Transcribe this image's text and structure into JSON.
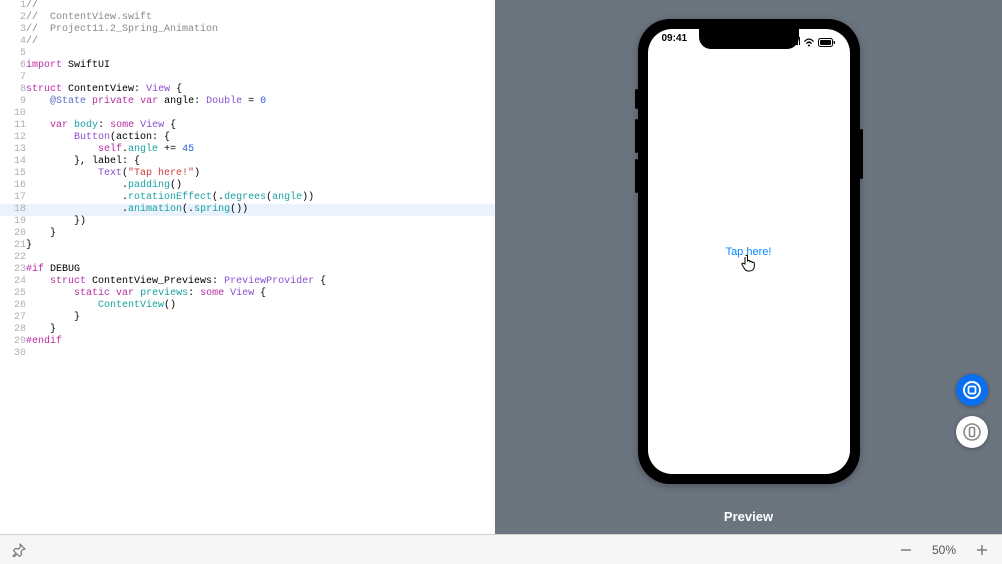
{
  "editor": {
    "highlighted_line": 18,
    "lines": [
      {
        "n": 1,
        "seg": [
          {
            "t": "//",
            "c": "c-comment"
          }
        ]
      },
      {
        "n": 2,
        "seg": [
          {
            "t": "//  ContentView.swift",
            "c": "c-comment"
          }
        ]
      },
      {
        "n": 3,
        "seg": [
          {
            "t": "//  Project11.2_Spring_Animation",
            "c": "c-comment"
          }
        ]
      },
      {
        "n": 4,
        "seg": [
          {
            "t": "//",
            "c": "c-comment"
          }
        ]
      },
      {
        "n": 5,
        "seg": [
          {
            "t": "",
            "c": ""
          }
        ]
      },
      {
        "n": 6,
        "seg": [
          {
            "t": "import",
            "c": "c-key"
          },
          {
            "t": " ",
            "c": ""
          },
          {
            "t": "SwiftUI",
            "c": "c-black"
          }
        ]
      },
      {
        "n": 7,
        "seg": [
          {
            "t": "",
            "c": ""
          }
        ]
      },
      {
        "n": 8,
        "seg": [
          {
            "t": "struct",
            "c": "c-key"
          },
          {
            "t": " ",
            "c": ""
          },
          {
            "t": "ContentView",
            "c": "c-black"
          },
          {
            "t": ": ",
            "c": ""
          },
          {
            "t": "View",
            "c": "c-purple"
          },
          {
            "t": " {",
            "c": ""
          }
        ]
      },
      {
        "n": 9,
        "seg": [
          {
            "t": "    ",
            "c": ""
          },
          {
            "t": "@State",
            "c": "c-type"
          },
          {
            "t": " ",
            "c": ""
          },
          {
            "t": "private",
            "c": "c-key"
          },
          {
            "t": " ",
            "c": ""
          },
          {
            "t": "var",
            "c": "c-key"
          },
          {
            "t": " angle: ",
            "c": ""
          },
          {
            "t": "Double",
            "c": "c-purple"
          },
          {
            "t": " = ",
            "c": ""
          },
          {
            "t": "0",
            "c": "c-num"
          }
        ]
      },
      {
        "n": 10,
        "seg": [
          {
            "t": "",
            "c": ""
          }
        ]
      },
      {
        "n": 11,
        "seg": [
          {
            "t": "    ",
            "c": ""
          },
          {
            "t": "var",
            "c": "c-key"
          },
          {
            "t": " ",
            "c": ""
          },
          {
            "t": "body",
            "c": "c-teal"
          },
          {
            "t": ": ",
            "c": ""
          },
          {
            "t": "some",
            "c": "c-key"
          },
          {
            "t": " ",
            "c": ""
          },
          {
            "t": "View",
            "c": "c-purple"
          },
          {
            "t": " {",
            "c": ""
          }
        ]
      },
      {
        "n": 12,
        "seg": [
          {
            "t": "        ",
            "c": ""
          },
          {
            "t": "Button",
            "c": "c-purple"
          },
          {
            "t": "(action: {",
            "c": ""
          }
        ]
      },
      {
        "n": 13,
        "seg": [
          {
            "t": "            ",
            "c": ""
          },
          {
            "t": "self",
            "c": "c-key"
          },
          {
            "t": ".",
            "c": ""
          },
          {
            "t": "angle",
            "c": "c-teal"
          },
          {
            "t": " += ",
            "c": ""
          },
          {
            "t": "45",
            "c": "c-num"
          }
        ]
      },
      {
        "n": 14,
        "seg": [
          {
            "t": "        }, label: {",
            "c": ""
          }
        ]
      },
      {
        "n": 15,
        "seg": [
          {
            "t": "            ",
            "c": ""
          },
          {
            "t": "Text",
            "c": "c-purple"
          },
          {
            "t": "(",
            "c": ""
          },
          {
            "t": "\"Tap here!\"",
            "c": "c-string"
          },
          {
            "t": ")",
            "c": ""
          }
        ]
      },
      {
        "n": 16,
        "seg": [
          {
            "t": "                .",
            "c": ""
          },
          {
            "t": "padding",
            "c": "c-teal"
          },
          {
            "t": "()",
            "c": ""
          }
        ]
      },
      {
        "n": 17,
        "seg": [
          {
            "t": "                .",
            "c": ""
          },
          {
            "t": "rotationEffect",
            "c": "c-teal"
          },
          {
            "t": "(.",
            "c": ""
          },
          {
            "t": "degrees",
            "c": "c-teal"
          },
          {
            "t": "(",
            "c": ""
          },
          {
            "t": "angle",
            "c": "c-teal"
          },
          {
            "t": "))",
            "c": ""
          }
        ]
      },
      {
        "n": 18,
        "seg": [
          {
            "t": "                .",
            "c": ""
          },
          {
            "t": "animation",
            "c": "c-teal"
          },
          {
            "t": "(.",
            "c": ""
          },
          {
            "t": "spring",
            "c": "c-teal"
          },
          {
            "t": "())",
            "c": ""
          }
        ]
      },
      {
        "n": 19,
        "seg": [
          {
            "t": "        })",
            "c": ""
          }
        ]
      },
      {
        "n": 20,
        "seg": [
          {
            "t": "    }",
            "c": ""
          }
        ]
      },
      {
        "n": 21,
        "seg": [
          {
            "t": "}",
            "c": ""
          }
        ]
      },
      {
        "n": 22,
        "seg": [
          {
            "t": "",
            "c": ""
          }
        ]
      },
      {
        "n": 23,
        "seg": [
          {
            "t": "#if",
            "c": "c-key"
          },
          {
            "t": " DEBUG",
            "c": ""
          }
        ]
      },
      {
        "n": 24,
        "seg": [
          {
            "t": "    ",
            "c": ""
          },
          {
            "t": "struct",
            "c": "c-key"
          },
          {
            "t": " ContentView_Previews: ",
            "c": ""
          },
          {
            "t": "PreviewProvider",
            "c": "c-purple"
          },
          {
            "t": " {",
            "c": ""
          }
        ]
      },
      {
        "n": 25,
        "seg": [
          {
            "t": "        ",
            "c": ""
          },
          {
            "t": "static",
            "c": "c-key"
          },
          {
            "t": " ",
            "c": ""
          },
          {
            "t": "var",
            "c": "c-key"
          },
          {
            "t": " ",
            "c": ""
          },
          {
            "t": "previews",
            "c": "c-teal"
          },
          {
            "t": ": ",
            "c": ""
          },
          {
            "t": "some",
            "c": "c-key"
          },
          {
            "t": " ",
            "c": ""
          },
          {
            "t": "View",
            "c": "c-purple"
          },
          {
            "t": " {",
            "c": ""
          }
        ]
      },
      {
        "n": 26,
        "seg": [
          {
            "t": "            ",
            "c": ""
          },
          {
            "t": "ContentView",
            "c": "c-teal"
          },
          {
            "t": "()",
            "c": ""
          }
        ]
      },
      {
        "n": 27,
        "seg": [
          {
            "t": "        }",
            "c": ""
          }
        ]
      },
      {
        "n": 28,
        "seg": [
          {
            "t": "    }",
            "c": ""
          }
        ]
      },
      {
        "n": 29,
        "seg": [
          {
            "t": "#endif",
            "c": "c-key"
          }
        ]
      },
      {
        "n": 30,
        "seg": [
          {
            "t": "",
            "c": ""
          }
        ]
      }
    ]
  },
  "preview": {
    "label": "Preview",
    "time": "09:41",
    "button_text": "Tap here!"
  },
  "bottombar": {
    "zoom": "50%"
  }
}
